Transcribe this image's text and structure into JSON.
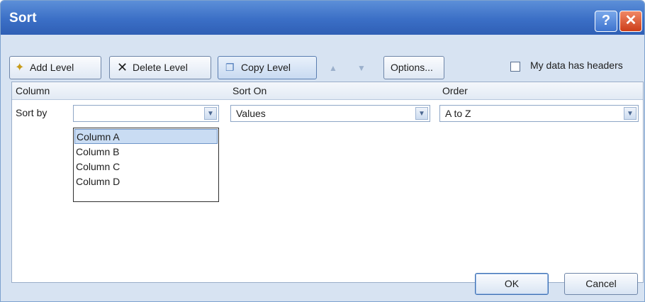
{
  "window": {
    "title": "Sort"
  },
  "titlebar": {
    "help_icon": "?",
    "close_icon": "✕"
  },
  "toolbar": {
    "add_level": {
      "label": "Add Level",
      "icon": "add-level-icon"
    },
    "delete_level": {
      "label": "Delete Level",
      "icon": "✕"
    },
    "copy_level": {
      "label": "Copy Level",
      "icon": "copy-icon"
    },
    "move_up_icon": "▲",
    "move_down_icon": "▼",
    "options": {
      "label": "Options..."
    },
    "headers_checkbox": {
      "label": "My data has headers",
      "checked": false
    }
  },
  "grid": {
    "headers": {
      "column": "Column",
      "sort_on": "Sort On",
      "order": "Order"
    },
    "rows": [
      {
        "label": "Sort by",
        "column_value": "",
        "sort_on_value": "Values",
        "order_value": "A to Z"
      }
    ]
  },
  "column_dropdown": {
    "options": [
      "Column A",
      "Column B",
      "Column C",
      "Column D"
    ],
    "highlighted": "Column A"
  },
  "footer": {
    "ok": "OK",
    "cancel": "Cancel"
  },
  "colors": {
    "titlebar": "#3b6fc6",
    "dialog_bg": "#d7e3f2",
    "highlight": "#c9dcf3"
  }
}
